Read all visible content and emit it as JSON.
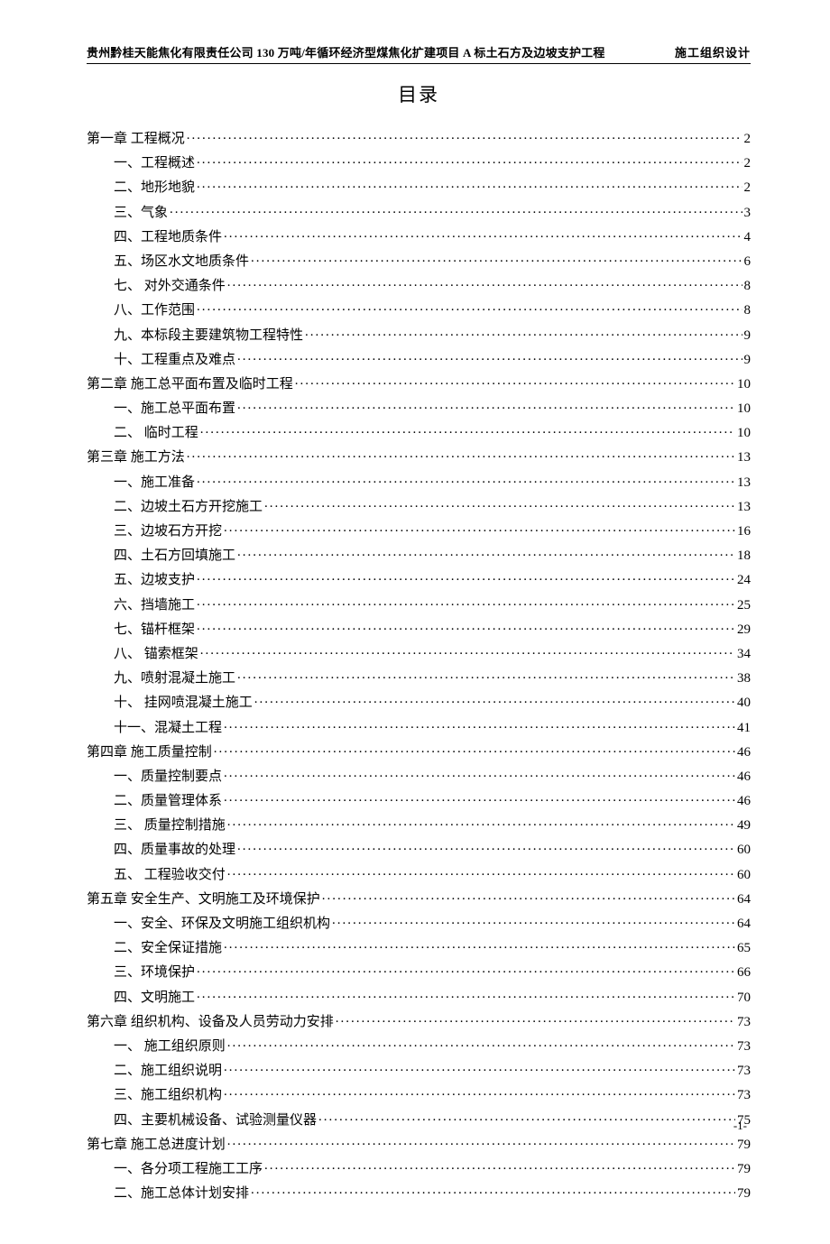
{
  "header": {
    "left": "贵州黔桂天能焦化有限责任公司 130 万吨/年循环经济型煤焦化扩建项目 A 标土石方及边坡支护工程",
    "right": "施工组织设计"
  },
  "title": "目录",
  "toc": [
    {
      "level": "chapter",
      "label": "第一章  工程概况",
      "page": "2"
    },
    {
      "level": "section",
      "label": "一、工程概述",
      "page": "2"
    },
    {
      "level": "section",
      "label": "二、地形地貌",
      "page": "2"
    },
    {
      "level": "section",
      "label": "三、气象",
      "page": "3"
    },
    {
      "level": "section",
      "label": "四、工程地质条件",
      "page": "4"
    },
    {
      "level": "section",
      "label": "五、场区水文地质条件",
      "page": "6"
    },
    {
      "level": "section",
      "label": "七、  对外交通条件",
      "page": "8"
    },
    {
      "level": "section",
      "label": "八、工作范围",
      "page": "8"
    },
    {
      "level": "section",
      "label": "九、本标段主要建筑物工程特性",
      "page": "9"
    },
    {
      "level": "section",
      "label": "十、工程重点及难点",
      "page": "9"
    },
    {
      "level": "chapter",
      "label": "第二章  施工总平面布置及临时工程",
      "page": "10"
    },
    {
      "level": "section",
      "label": "一、施工总平面布置",
      "page": "10"
    },
    {
      "level": "section",
      "label": "二、  临时工程",
      "page": "10"
    },
    {
      "level": "chapter",
      "label": "第三章    施工方法",
      "page": "13"
    },
    {
      "level": "section",
      "label": "一、施工准备",
      "page": "13"
    },
    {
      "level": "section",
      "label": "二、边坡土石方开挖施工",
      "page": "13"
    },
    {
      "level": "section",
      "label": "三、边坡石方开挖",
      "page": "16"
    },
    {
      "level": "section",
      "label": "四、土石方回填施工",
      "page": "18"
    },
    {
      "level": "section",
      "label": "五、边坡支护",
      "page": "24"
    },
    {
      "level": "section",
      "label": "六、挡墙施工",
      "page": "25"
    },
    {
      "level": "section",
      "label": "七、锚杆框架",
      "page": "29"
    },
    {
      "level": "section",
      "label": "八、  锚索框架",
      "page": "34"
    },
    {
      "level": "section",
      "label": "九、喷射混凝土施工",
      "page": "38"
    },
    {
      "level": "section",
      "label": "十、  挂网喷混凝土施工",
      "page": "40"
    },
    {
      "level": "section",
      "label": "十一、混凝土工程",
      "page": "41"
    },
    {
      "level": "chapter",
      "label": "第四章    施工质量控制",
      "page": "46"
    },
    {
      "level": "section",
      "label": "一、质量控制要点",
      "page": "46"
    },
    {
      "level": "section",
      "label": "二、质量管理体系",
      "page": "46"
    },
    {
      "level": "section",
      "label": "三、  质量控制措施",
      "page": "49"
    },
    {
      "level": "section",
      "label": "四、质量事故的处理",
      "page": "60"
    },
    {
      "level": "section",
      "label": "五、  工程验收交付",
      "page": "60"
    },
    {
      "level": "chapter",
      "label": "第五章    安全生产、文明施工及环境保护",
      "page": "64"
    },
    {
      "level": "section",
      "label": "一、安全、环保及文明施工组织机构",
      "page": "64"
    },
    {
      "level": "section",
      "label": "二、安全保证措施",
      "page": "65"
    },
    {
      "level": "section",
      "label": "三、环境保护",
      "page": "66"
    },
    {
      "level": "section",
      "label": "四、文明施工",
      "page": "70"
    },
    {
      "level": "chapter",
      "label": "第六章  组织机构、设备及人员劳动力安排",
      "page": "73"
    },
    {
      "level": "section",
      "label": "一、  施工组织原则",
      "page": "73"
    },
    {
      "level": "section",
      "label": "二、施工组织说明",
      "page": "73"
    },
    {
      "level": "section",
      "label": "三、施工组织机构",
      "page": "73"
    },
    {
      "level": "section",
      "label": "四、主要机械设备、试验测量仪器",
      "page": "75"
    },
    {
      "level": "chapter",
      "label": "第七章 施工总进度计划",
      "page": "79"
    },
    {
      "level": "section",
      "label": "一、各分项工程施工工序",
      "page": "79"
    },
    {
      "level": "section",
      "label": "二、施工总体计划安排",
      "page": "79"
    }
  ],
  "footer": {
    "page_number": "-1-"
  }
}
